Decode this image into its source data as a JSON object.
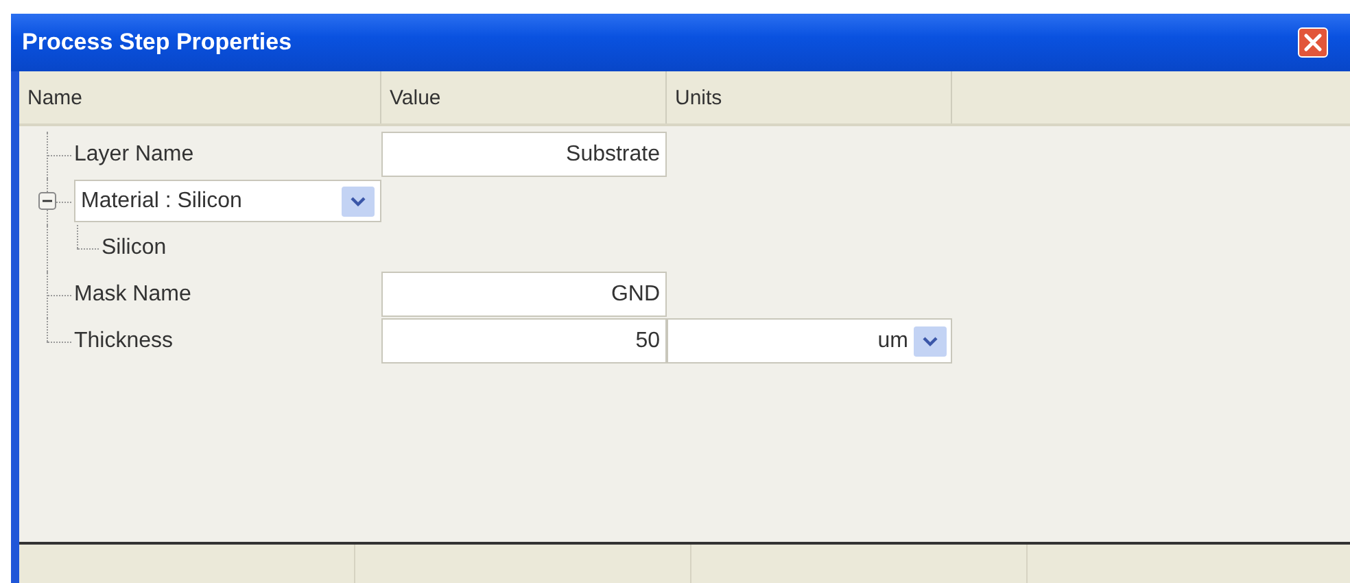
{
  "window": {
    "title": "Process Step Properties"
  },
  "columns": [
    "Name",
    "Value",
    "Units"
  ],
  "properties": [
    {
      "kind": "text",
      "name": "Layer Name",
      "value": "Substrate"
    },
    {
      "kind": "combo",
      "name": "Material : Silicon",
      "expanded": true,
      "children": [
        {
          "name": "Silicon"
        }
      ]
    },
    {
      "kind": "text",
      "name": "Mask Name",
      "value": "GND"
    },
    {
      "kind": "text",
      "name": "Thickness",
      "value": "50",
      "units": "um"
    }
  ]
}
